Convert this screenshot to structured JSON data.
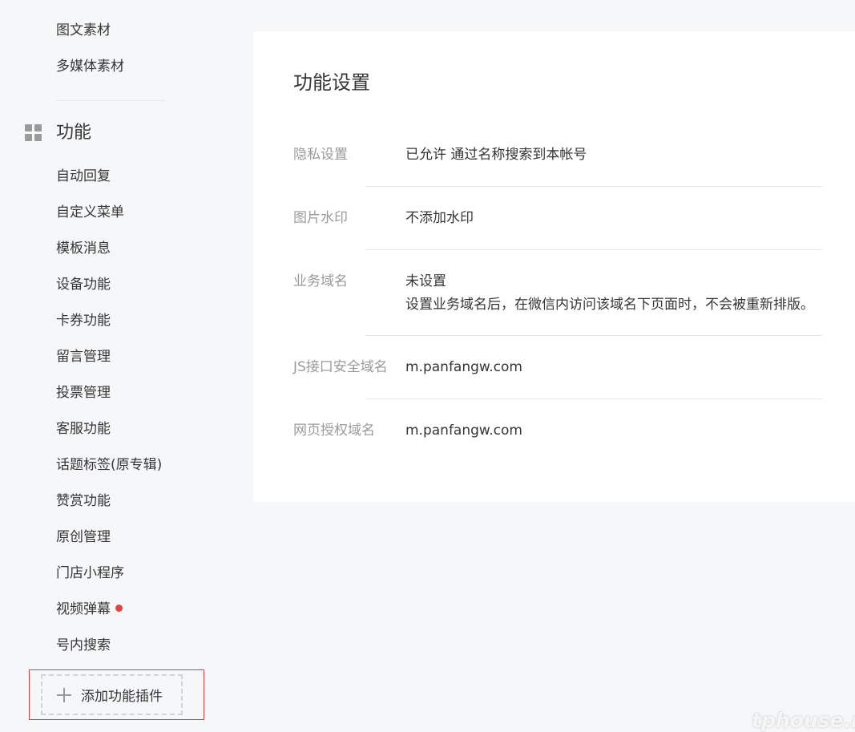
{
  "sidebar": {
    "top_items": [
      "图文素材",
      "多媒体素材"
    ],
    "group_icon": "grid-icon",
    "group_title": "功能",
    "items": [
      {
        "label": "自动回复"
      },
      {
        "label": "自定义菜单"
      },
      {
        "label": "模板消息"
      },
      {
        "label": "设备功能"
      },
      {
        "label": "卡券功能"
      },
      {
        "label": "留言管理"
      },
      {
        "label": "投票管理"
      },
      {
        "label": "客服功能"
      },
      {
        "label": "话题标签(原专辑)"
      },
      {
        "label": "赞赏功能"
      },
      {
        "label": "原创管理"
      },
      {
        "label": "门店小程序"
      },
      {
        "label": "视频弹幕",
        "badge": "red-dot"
      },
      {
        "label": "号内搜索"
      }
    ],
    "add_plugin_label": "添加功能插件",
    "add_plugin_icon": "plus-icon"
  },
  "panel": {
    "title": "功能设置",
    "rows": [
      {
        "label": "隐私设置",
        "value": "已允许 通过名称搜索到本帐号"
      },
      {
        "label": "图片水印",
        "value": "不添加水印"
      },
      {
        "label": "业务域名",
        "value": "未设置",
        "note": "设置业务域名后，在微信内访问该域名下页面时，不会被重新排版。"
      },
      {
        "label": "JS接口安全域名",
        "value": "m.panfangw.com"
      },
      {
        "label": "网页授权域名",
        "value": "m.panfangw.com"
      }
    ]
  },
  "watermark": "tphouse.net",
  "colors": {
    "background": "#f6f7f9",
    "panel": "#ffffff",
    "text": "#353535",
    "muted": "#9a9a9a",
    "badge": "#e64340",
    "highlight": "#e0393e"
  }
}
